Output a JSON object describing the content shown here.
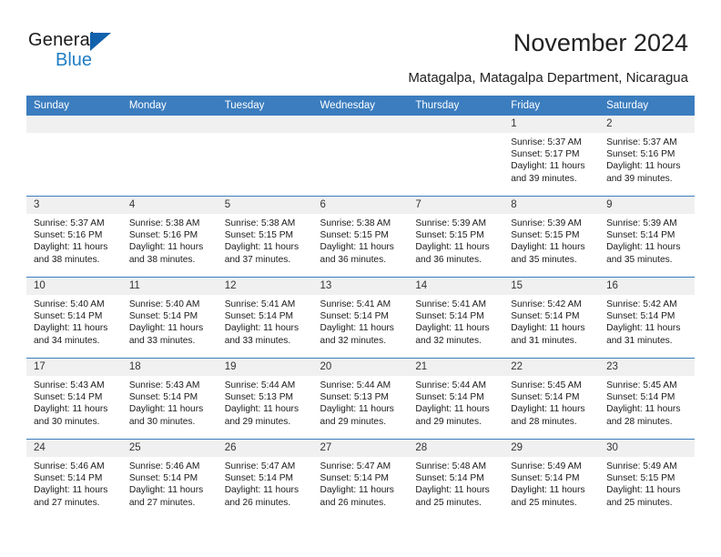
{
  "brand": {
    "name_top": "General",
    "name_bottom": "Blue",
    "triangle_color": "#1161ad",
    "blue_color": "#1f7dc4"
  },
  "header": {
    "title": "November 2024",
    "subtitle": "Matagalpa, Matagalpa Department, Nicaragua"
  },
  "theme": {
    "header_blue": "#3b7dbf",
    "daynum_gray": "#f0f0f0",
    "text": "#1a1a1a"
  },
  "calendar": {
    "weekday_headers": [
      "Sunday",
      "Monday",
      "Tuesday",
      "Wednesday",
      "Thursday",
      "Friday",
      "Saturday"
    ],
    "weeks": [
      [
        {
          "day": "",
          "sunrise": "",
          "sunset": "",
          "daylight": "",
          "blank": true
        },
        {
          "day": "",
          "sunrise": "",
          "sunset": "",
          "daylight": "",
          "blank": true
        },
        {
          "day": "",
          "sunrise": "",
          "sunset": "",
          "daylight": "",
          "blank": true
        },
        {
          "day": "",
          "sunrise": "",
          "sunset": "",
          "daylight": "",
          "blank": true
        },
        {
          "day": "",
          "sunrise": "",
          "sunset": "",
          "daylight": "",
          "blank": true
        },
        {
          "day": "1",
          "sunrise": "Sunrise: 5:37 AM",
          "sunset": "Sunset: 5:17 PM",
          "daylight": "Daylight: 11 hours and 39 minutes."
        },
        {
          "day": "2",
          "sunrise": "Sunrise: 5:37 AM",
          "sunset": "Sunset: 5:16 PM",
          "daylight": "Daylight: 11 hours and 39 minutes."
        }
      ],
      [
        {
          "day": "3",
          "sunrise": "Sunrise: 5:37 AM",
          "sunset": "Sunset: 5:16 PM",
          "daylight": "Daylight: 11 hours and 38 minutes."
        },
        {
          "day": "4",
          "sunrise": "Sunrise: 5:38 AM",
          "sunset": "Sunset: 5:16 PM",
          "daylight": "Daylight: 11 hours and 38 minutes."
        },
        {
          "day": "5",
          "sunrise": "Sunrise: 5:38 AM",
          "sunset": "Sunset: 5:15 PM",
          "daylight": "Daylight: 11 hours and 37 minutes."
        },
        {
          "day": "6",
          "sunrise": "Sunrise: 5:38 AM",
          "sunset": "Sunset: 5:15 PM",
          "daylight": "Daylight: 11 hours and 36 minutes."
        },
        {
          "day": "7",
          "sunrise": "Sunrise: 5:39 AM",
          "sunset": "Sunset: 5:15 PM",
          "daylight": "Daylight: 11 hours and 36 minutes."
        },
        {
          "day": "8",
          "sunrise": "Sunrise: 5:39 AM",
          "sunset": "Sunset: 5:15 PM",
          "daylight": "Daylight: 11 hours and 35 minutes."
        },
        {
          "day": "9",
          "sunrise": "Sunrise: 5:39 AM",
          "sunset": "Sunset: 5:14 PM",
          "daylight": "Daylight: 11 hours and 35 minutes."
        }
      ],
      [
        {
          "day": "10",
          "sunrise": "Sunrise: 5:40 AM",
          "sunset": "Sunset: 5:14 PM",
          "daylight": "Daylight: 11 hours and 34 minutes."
        },
        {
          "day": "11",
          "sunrise": "Sunrise: 5:40 AM",
          "sunset": "Sunset: 5:14 PM",
          "daylight": "Daylight: 11 hours and 33 minutes."
        },
        {
          "day": "12",
          "sunrise": "Sunrise: 5:41 AM",
          "sunset": "Sunset: 5:14 PM",
          "daylight": "Daylight: 11 hours and 33 minutes."
        },
        {
          "day": "13",
          "sunrise": "Sunrise: 5:41 AM",
          "sunset": "Sunset: 5:14 PM",
          "daylight": "Daylight: 11 hours and 32 minutes."
        },
        {
          "day": "14",
          "sunrise": "Sunrise: 5:41 AM",
          "sunset": "Sunset: 5:14 PM",
          "daylight": "Daylight: 11 hours and 32 minutes."
        },
        {
          "day": "15",
          "sunrise": "Sunrise: 5:42 AM",
          "sunset": "Sunset: 5:14 PM",
          "daylight": "Daylight: 11 hours and 31 minutes."
        },
        {
          "day": "16",
          "sunrise": "Sunrise: 5:42 AM",
          "sunset": "Sunset: 5:14 PM",
          "daylight": "Daylight: 11 hours and 31 minutes."
        }
      ],
      [
        {
          "day": "17",
          "sunrise": "Sunrise: 5:43 AM",
          "sunset": "Sunset: 5:14 PM",
          "daylight": "Daylight: 11 hours and 30 minutes."
        },
        {
          "day": "18",
          "sunrise": "Sunrise: 5:43 AM",
          "sunset": "Sunset: 5:14 PM",
          "daylight": "Daylight: 11 hours and 30 minutes."
        },
        {
          "day": "19",
          "sunrise": "Sunrise: 5:44 AM",
          "sunset": "Sunset: 5:13 PM",
          "daylight": "Daylight: 11 hours and 29 minutes."
        },
        {
          "day": "20",
          "sunrise": "Sunrise: 5:44 AM",
          "sunset": "Sunset: 5:13 PM",
          "daylight": "Daylight: 11 hours and 29 minutes."
        },
        {
          "day": "21",
          "sunrise": "Sunrise: 5:44 AM",
          "sunset": "Sunset: 5:14 PM",
          "daylight": "Daylight: 11 hours and 29 minutes."
        },
        {
          "day": "22",
          "sunrise": "Sunrise: 5:45 AM",
          "sunset": "Sunset: 5:14 PM",
          "daylight": "Daylight: 11 hours and 28 minutes."
        },
        {
          "day": "23",
          "sunrise": "Sunrise: 5:45 AM",
          "sunset": "Sunset: 5:14 PM",
          "daylight": "Daylight: 11 hours and 28 minutes."
        }
      ],
      [
        {
          "day": "24",
          "sunrise": "Sunrise: 5:46 AM",
          "sunset": "Sunset: 5:14 PM",
          "daylight": "Daylight: 11 hours and 27 minutes."
        },
        {
          "day": "25",
          "sunrise": "Sunrise: 5:46 AM",
          "sunset": "Sunset: 5:14 PM",
          "daylight": "Daylight: 11 hours and 27 minutes."
        },
        {
          "day": "26",
          "sunrise": "Sunrise: 5:47 AM",
          "sunset": "Sunset: 5:14 PM",
          "daylight": "Daylight: 11 hours and 26 minutes."
        },
        {
          "day": "27",
          "sunrise": "Sunrise: 5:47 AM",
          "sunset": "Sunset: 5:14 PM",
          "daylight": "Daylight: 11 hours and 26 minutes."
        },
        {
          "day": "28",
          "sunrise": "Sunrise: 5:48 AM",
          "sunset": "Sunset: 5:14 PM",
          "daylight": "Daylight: 11 hours and 25 minutes."
        },
        {
          "day": "29",
          "sunrise": "Sunrise: 5:49 AM",
          "sunset": "Sunset: 5:14 PM",
          "daylight": "Daylight: 11 hours and 25 minutes."
        },
        {
          "day": "30",
          "sunrise": "Sunrise: 5:49 AM",
          "sunset": "Sunset: 5:15 PM",
          "daylight": "Daylight: 11 hours and 25 minutes."
        }
      ]
    ]
  }
}
